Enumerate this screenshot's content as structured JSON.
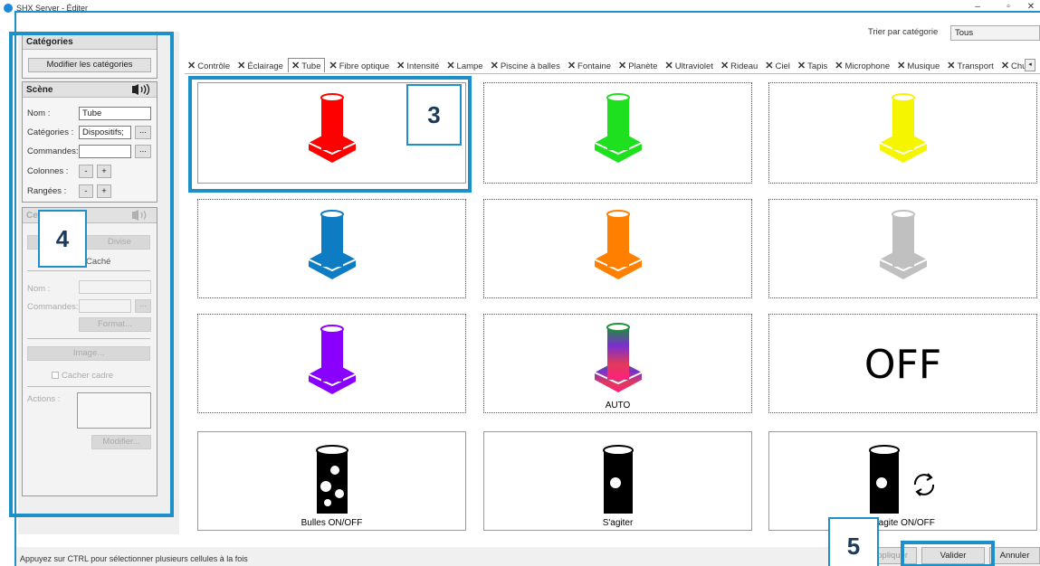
{
  "window": {
    "title": "SHX Server - Éditer",
    "minimize": "–",
    "maximize": "▫",
    "close": "✕"
  },
  "callouts": {
    "three": "3",
    "four": "4",
    "five": "5"
  },
  "categories_panel": {
    "header": "Catégories",
    "edit_button": "Modifier les catégories"
  },
  "scene_panel": {
    "header": "Scène",
    "name_label": "Nom :",
    "name_value": "Tube",
    "categories_label": "Catégories :",
    "categories_value": "Dispositifs;",
    "commands_label": "Commandes:",
    "commands_value": "",
    "browse": "...",
    "columns_label": "Colonnes :",
    "rows_label": "Rangées :",
    "minus": "-",
    "plus": "+",
    "sound_icon": "sound-icon"
  },
  "cell_panel": {
    "header": "Cellule",
    "divide_button": "Divise",
    "hidden_label": "Caché",
    "name_label": "Nom :",
    "commands_label": "Commandes:",
    "browse": "...",
    "format_button": "Format...",
    "image_button": "Image...",
    "hide_frame_label": "Cacher cadre",
    "actions_label": "Actions :",
    "modify_button": "Modifier..."
  },
  "toolbar": {
    "sort_label": "Trier par catégorie",
    "sort_value": "Tous"
  },
  "tabs": [
    {
      "label": "Contrôle"
    },
    {
      "label": "Éclairage"
    },
    {
      "label": "Tube",
      "active": true
    },
    {
      "label": "Fibre optique"
    },
    {
      "label": "Intensité"
    },
    {
      "label": "Lampe"
    },
    {
      "label": "Piscine à balles"
    },
    {
      "label": "Fontaine"
    },
    {
      "label": "Planète"
    },
    {
      "label": "Ultraviolet"
    },
    {
      "label": "Rideau"
    },
    {
      "label": "Ciel"
    },
    {
      "label": "Tapis"
    },
    {
      "label": "Microphone"
    },
    {
      "label": "Musique"
    },
    {
      "label": "Transport"
    },
    {
      "label": "Chu"
    }
  ],
  "tab_scroll": "◂",
  "cells": [
    {
      "type": "tube",
      "color": "#ff0000",
      "label": ""
    },
    {
      "type": "tube",
      "color": "#1ee01e",
      "label": ""
    },
    {
      "type": "tube",
      "color": "#f5f500",
      "label": ""
    },
    {
      "type": "tube",
      "color": "#0e7cc2",
      "label": ""
    },
    {
      "type": "tube",
      "color": "#ff8000",
      "label": ""
    },
    {
      "type": "tube",
      "color": "#c0c0c0",
      "label": ""
    },
    {
      "type": "tube",
      "color": "#8a00ff",
      "label": ""
    },
    {
      "type": "tube-auto",
      "color": "rainbow",
      "label": "AUTO"
    },
    {
      "type": "off",
      "color": "#000000",
      "label": "",
      "text": "OFF"
    },
    {
      "type": "bubbles",
      "color": "#000000",
      "label": "Bulles ON/OFF"
    },
    {
      "type": "shake",
      "color": "#000000",
      "label": "S'agiter"
    },
    {
      "type": "shake-auto",
      "color": "#000000",
      "label": "S'agite ON/OFF"
    }
  ],
  "footer": {
    "status": "Appuyez sur CTRL pour sélectionner plusieurs cellules à la fois",
    "apply_button": "Appliquer",
    "validate_button": "Valider",
    "cancel_button": "Annuler"
  },
  "colors": {
    "accent": "#1e90c8",
    "callout_text": "#1b3a5c"
  }
}
